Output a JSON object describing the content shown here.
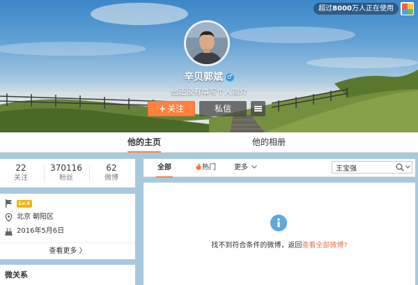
{
  "header": {
    "online_badge_prefix": "超过",
    "online_badge_count": "8000",
    "online_badge_suffix": "万人正在使用"
  },
  "profile": {
    "name": "辛贝郭斌",
    "gender_symbol": "♂",
    "intro": "他还没有填写个人简介",
    "follow_label": "关注",
    "follow_plus": "+",
    "message_label": "私信"
  },
  "tabs": [
    {
      "label": "他的主页",
      "active": true
    },
    {
      "label": "他的相册",
      "active": false
    }
  ],
  "stats": [
    {
      "value": "22",
      "label": "关注"
    },
    {
      "value": "370116",
      "label": "粉丝"
    },
    {
      "value": "62",
      "label": "微博"
    }
  ],
  "info": {
    "level": "Lv.4",
    "location": "北京 朝阳区",
    "birthday": "2016年5月6日",
    "see_more": "查看更多 〉"
  },
  "relations": {
    "title": "微关系"
  },
  "feed": {
    "tabs": [
      {
        "label": "全部",
        "active": true
      },
      {
        "label": "热门",
        "active": false,
        "icon": "fire-icon"
      },
      {
        "label": "更多",
        "active": false,
        "icon": "chevron-down-icon"
      }
    ],
    "search_value": "王宝强",
    "empty_message": "找不到符合条件的微博，返回",
    "empty_link": "查看全部微博?"
  },
  "colors": {
    "accent_orange": "#ff8140",
    "link_orange": "#eb7350",
    "info_blue": "#5ea7e0",
    "level_gold": "#f5b400",
    "page_bg": "#a6c9de"
  }
}
